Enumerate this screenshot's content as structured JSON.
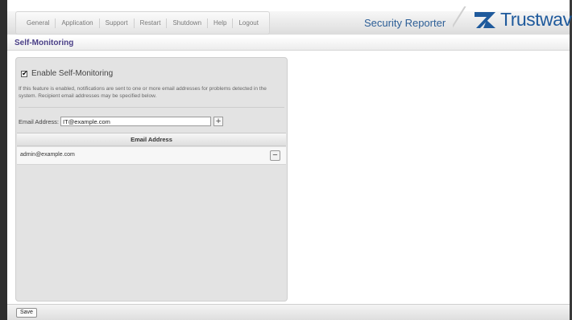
{
  "nav": {
    "items": [
      {
        "label": "General"
      },
      {
        "label": "Application"
      },
      {
        "label": "Support"
      },
      {
        "label": "Restart"
      },
      {
        "label": "Shutdown"
      },
      {
        "label": "Help"
      },
      {
        "label": "Logout"
      }
    ]
  },
  "brand": {
    "product_title": "Security Reporter",
    "logo_text": "Trustwave",
    "logo_reg": "®",
    "accent_color": "#1f5a9c"
  },
  "page": {
    "title": "Self-Monitoring"
  },
  "panel": {
    "enable_label": "Enable Self-Monitoring",
    "enable_checked": true,
    "description": "If this feature is enabled, notifications are sent to one or more email addresses for problems detected in the system. Recipient email addresses may be specified below.",
    "email_label": "Email Address:",
    "email_value": "IT@example.com",
    "add_symbol": "+",
    "table": {
      "header": "Email Address",
      "rows": [
        {
          "email": "admin@example.com",
          "remove_symbol": "−"
        }
      ]
    }
  },
  "footer": {
    "save_label": "Save"
  }
}
